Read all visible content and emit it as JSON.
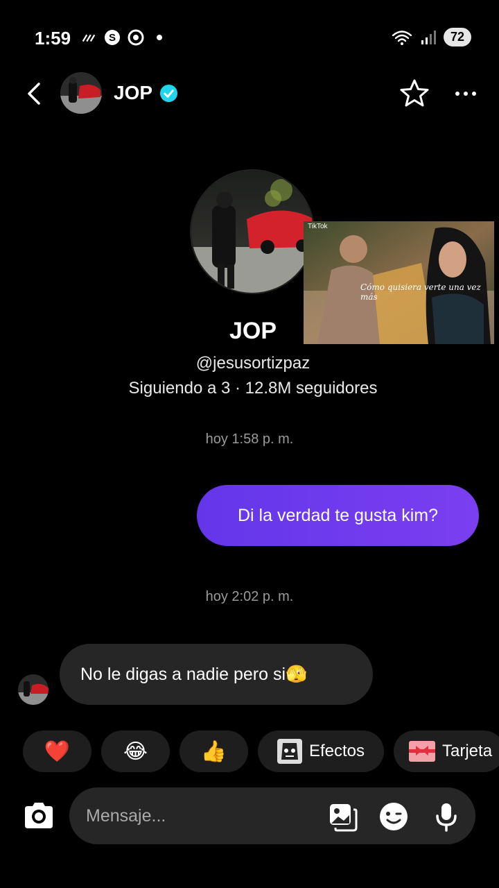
{
  "status_bar": {
    "time": "1:59",
    "battery": "72"
  },
  "header": {
    "name": "JOP",
    "icons": [
      "back-arrow-icon",
      "verified-icon",
      "star-icon",
      "more-icon"
    ]
  },
  "profile": {
    "name": "JOP",
    "handle": "@jesusortizpaz",
    "stats": "Siguiendo a 3 · 12.8M seguidores",
    "video_overlay": {
      "logo_text": "TikTok",
      "caption": "Cómo quisiera verte una vez más"
    }
  },
  "messages": [
    {
      "timestamp": "hoy 1:58 p. m.",
      "direction": "outgoing",
      "text": "Di la verdad te gusta kim?"
    },
    {
      "timestamp": "hoy 2:02 p. m.",
      "direction": "incoming",
      "text": "No le digas a nadie pero si🫣"
    }
  ],
  "quick_actions": [
    {
      "type": "emoji",
      "emoji": "❤️"
    },
    {
      "type": "emoji",
      "emoji": "😂"
    },
    {
      "type": "emoji",
      "emoji": "👍"
    },
    {
      "type": "button",
      "label": "Efectos",
      "icon": "effects-icon"
    },
    {
      "type": "button",
      "label": "Tarjeta",
      "icon": "gift-card-icon"
    }
  ],
  "composer": {
    "placeholder": "Mensaje..."
  },
  "colors": {
    "background": "#000000",
    "outgoing_bubble": "#6a3aec",
    "incoming_bubble": "#262626",
    "verified": "#20d5ec"
  }
}
